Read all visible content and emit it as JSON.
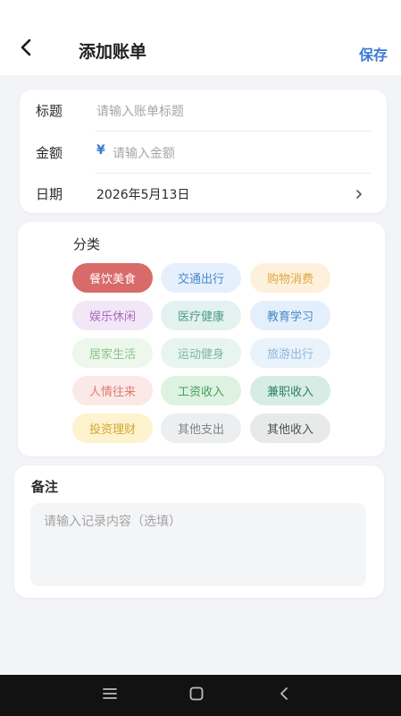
{
  "header": {
    "title": "添加账单",
    "save_label": "保存"
  },
  "form": {
    "title_label": "标题",
    "title_placeholder": "请输入账单标题",
    "amount_label": "金额",
    "amount_symbol": "¥",
    "amount_placeholder": "请输入金额",
    "date_label": "日期",
    "date_value": "2026年5月13日"
  },
  "categories": {
    "title": "分类",
    "selected": "餐饮美食",
    "items": [
      {
        "label": "餐饮美食",
        "bg": "#d86a6a",
        "fg": "#ffffff"
      },
      {
        "label": "交通出行",
        "bg": "#e6f0fc",
        "fg": "#4a86d0"
      },
      {
        "label": "购物消费",
        "bg": "#fdf1dc",
        "fg": "#e0a644"
      },
      {
        "label": "娱乐休闲",
        "bg": "#f2e7f6",
        "fg": "#a96bc0"
      },
      {
        "label": "医疗健康",
        "bg": "#e3f2ee",
        "fg": "#4a9d8a"
      },
      {
        "label": "教育学习",
        "bg": "#e3f0fb",
        "fg": "#4a86c8"
      },
      {
        "label": "居家生活",
        "bg": "#edf7ec",
        "fg": "#8cc48a"
      },
      {
        "label": "运动健身",
        "bg": "#e8f4ef",
        "fg": "#7ab8a4"
      },
      {
        "label": "旅游出行",
        "bg": "#eaf3fb",
        "fg": "#8db6dc"
      },
      {
        "label": "人情往来",
        "bg": "#fbe9e7",
        "fg": "#de7b72"
      },
      {
        "label": "工资收入",
        "bg": "#def2e1",
        "fg": "#45a05a"
      },
      {
        "label": "兼职收入",
        "bg": "#d6ece4",
        "fg": "#2f7f68"
      },
      {
        "label": "投资理财",
        "bg": "#fdf3cf",
        "fg": "#d4a531"
      },
      {
        "label": "其他支出",
        "bg": "#eceeef",
        "fg": "#808487"
      },
      {
        "label": "其他收入",
        "bg": "#e8eaea",
        "fg": "#4c4f52"
      }
    ]
  },
  "note": {
    "title": "备注",
    "placeholder": "请输入记录内容（选填）"
  },
  "colors": {
    "accent": "#3a7ad6",
    "background": "#f3f4f7"
  },
  "icons": {
    "back": "chevron-left-icon",
    "date_arrow": "chevron-right-icon",
    "nav_menu": "menu-icon",
    "nav_home": "square-icon",
    "nav_back": "triangle-back-icon"
  }
}
